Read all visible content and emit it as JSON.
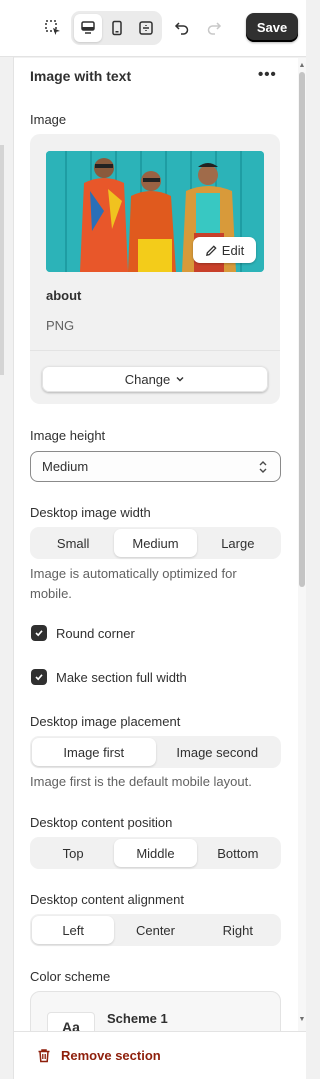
{
  "toolbar": {
    "icons": [
      "select-element-icon",
      "desktop-icon",
      "mobile-icon",
      "fullscreen-icon",
      "undo-icon",
      "redo-icon"
    ],
    "save_label": "Save"
  },
  "section": {
    "title": "Image with text",
    "more_label": "•••"
  },
  "image": {
    "label": "Image",
    "file_name": "about",
    "file_type": "PNG",
    "edit_label": "Edit",
    "change_label": "Change"
  },
  "image_height": {
    "label": "Image height",
    "value": "Medium"
  },
  "desktop_image_width": {
    "label": "Desktop image width",
    "options": [
      "Small",
      "Medium",
      "Large"
    ],
    "selected": "Medium",
    "hint": "Image is automatically optimized for mobile."
  },
  "round_corner": {
    "label": "Round corner",
    "checked": true
  },
  "full_width": {
    "label": "Make section full width",
    "checked": true
  },
  "placement": {
    "label": "Desktop image placement",
    "options": [
      "Image first",
      "Image second"
    ],
    "selected": "Image first",
    "hint": "Image first is the default mobile layout."
  },
  "content_position": {
    "label": "Desktop content position",
    "options": [
      "Top",
      "Middle",
      "Bottom"
    ],
    "selected": "Middle"
  },
  "content_alignment": {
    "label": "Desktop content alignment",
    "options": [
      "Left",
      "Center",
      "Right"
    ],
    "selected": "Left"
  },
  "color_scheme": {
    "label": "Color scheme",
    "swatch_text": "Aa",
    "value": "Scheme 1"
  },
  "footer": {
    "remove_label": "Remove section"
  },
  "colors": {
    "accent": "#303030",
    "danger": "#8e1f0b",
    "photo_bg": "#27b0b6"
  }
}
